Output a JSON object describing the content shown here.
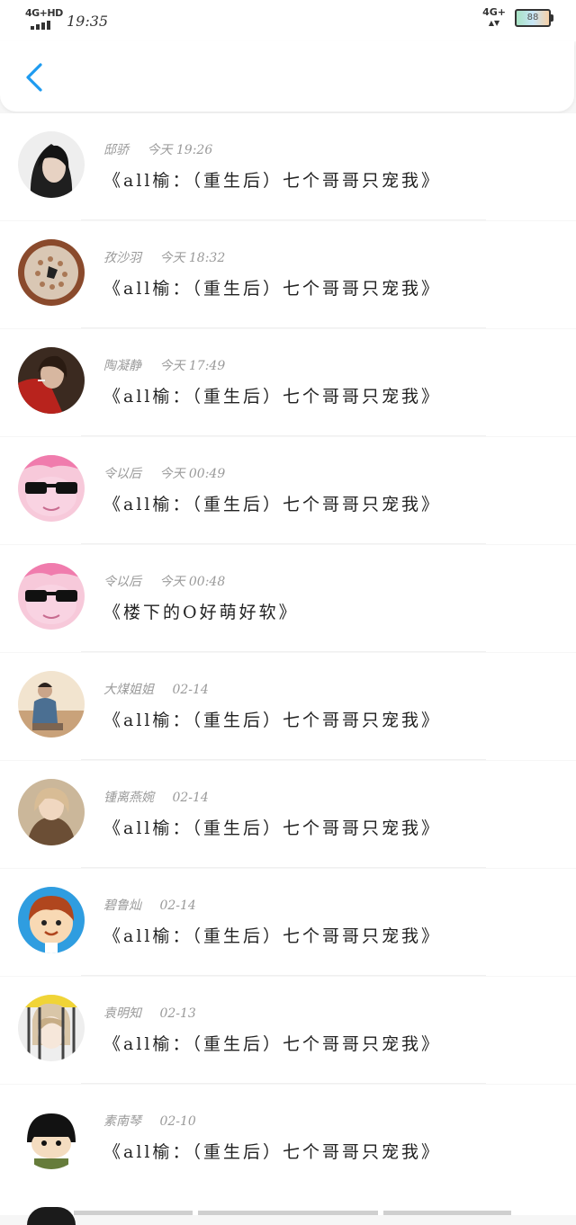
{
  "status_bar": {
    "network_left": "4G+HD",
    "time": "19:35",
    "network_right": "4G+",
    "battery": "88"
  },
  "header": {
    "back_icon": "chevron-left-icon",
    "accent_color": "#1e9bf0"
  },
  "comments": [
    {
      "name": "邸骄",
      "time": "今天 19:26",
      "text": "《all榆：（重生后）七个哥哥只宠我》",
      "avatar": "avatar-girl-dark-hair"
    },
    {
      "name": "孜沙羽",
      "time": "今天 18:32",
      "text": "《all榆：（重生后）七个哥哥只宠我》",
      "avatar": "avatar-sea-urchin"
    },
    {
      "name": "陶凝静",
      "time": "今天 17:49",
      "text": "《all榆：（重生后）七个哥哥只宠我》",
      "avatar": "avatar-girl-red"
    },
    {
      "name": "令以后",
      "time": "今天 00:49",
      "text": "《all榆：（重生后）七个哥哥只宠我》",
      "avatar": "avatar-pink-pony-sunglasses"
    },
    {
      "name": "令以后",
      "time": "今天 00:48",
      "text": "《楼下的O好萌好软》",
      "avatar": "avatar-pink-pony-sunglasses"
    },
    {
      "name": "大煤姐姐",
      "time": "02-14",
      "text": "《all榆：（重生后）七个哥哥只宠我》",
      "avatar": "avatar-boy-sitting"
    },
    {
      "name": "锺离燕婉",
      "time": "02-14",
      "text": "《all榆：（重生后）七个哥哥只宠我》",
      "avatar": "avatar-girl-fur"
    },
    {
      "name": "碧鲁灿",
      "time": "02-14",
      "text": "《all榆：（重生后）七个哥哥只宠我》",
      "avatar": "avatar-cartoon-boy"
    },
    {
      "name": "袁明知",
      "time": "02-13",
      "text": "《all榆：（重生后）七个哥哥只宠我》",
      "avatar": "avatar-anime-jail"
    },
    {
      "name": "素南琴",
      "time": "02-10",
      "text": "《all榆：（重生后）七个哥哥只宠我》",
      "avatar": "avatar-cartoon-bowlcut"
    }
  ]
}
